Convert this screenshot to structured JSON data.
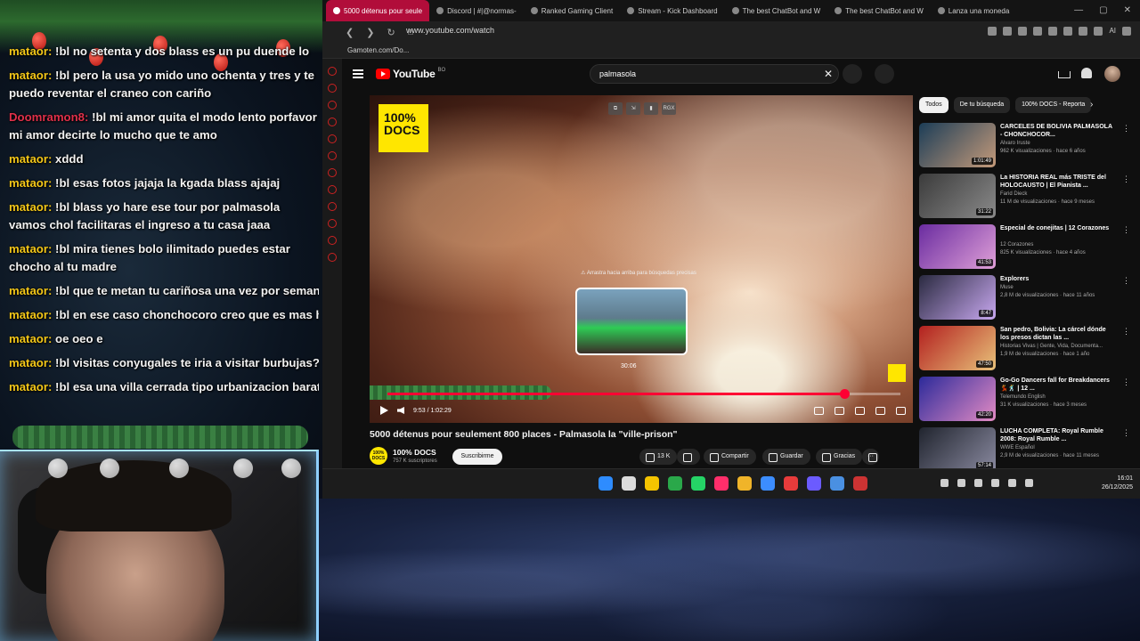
{
  "chat": {
    "messages": [
      {
        "user": "mataor:",
        "text": "!bl no setenta y dos blass es un pu duende lo",
        "red": false
      },
      {
        "user": "mataor:",
        "text": "!bl pero la usa yo mido uno ochenta y tres y te puedo reventar el craneo con cariño",
        "red": false
      },
      {
        "user": "Doomramon8:",
        "text": "!bl mi amor quita el modo lento porfavor mi amor decirte lo mucho que te amo",
        "red": true
      },
      {
        "user": "mataor:",
        "text": "xddd",
        "red": false
      },
      {
        "user": "mataor:",
        "text": "!bl esas fotos jajaja la kgada blass ajajaj",
        "red": false
      },
      {
        "user": "mataor:",
        "text": "!bl blass yo hare ese tour por palmasola vamos chol facilitaras el ingreso a tu casa jaaa",
        "red": false
      },
      {
        "user": "mataor:",
        "text": "!bl mira tienes bolo ilimitado puedes estar chocho al tu madre",
        "red": false
      },
      {
        "user": "mataor:",
        "text": "!bl que te metan tu cariñosa una vez por semana y b",
        "red": false
      },
      {
        "user": "mataor:",
        "text": "!bl en ese caso chonchocoro creo que es mas heavy",
        "red": false
      },
      {
        "user": "mataor:",
        "text": "oe oeo e",
        "red": false
      },
      {
        "user": "mataor:",
        "text": "!bl visitas conyugales te iria a visitar burbujas?",
        "red": false
      },
      {
        "user": "mataor:",
        "text": "!bl esa una villa cerrada tipo urbanizacion barata",
        "red": false
      }
    ]
  },
  "browser": {
    "tabs": [
      {
        "label": "5000 détenus pour seule",
        "active": true
      },
      {
        "label": "Discord | #|@normas-",
        "active": false
      },
      {
        "label": "Ranked Gaming Client",
        "active": false
      },
      {
        "label": "Stream - Kick Dashboard",
        "active": false
      },
      {
        "label": "The best ChatBot and W",
        "active": false
      },
      {
        "label": "The best ChatBot and W",
        "active": false
      },
      {
        "label": "Lanza una moneda",
        "active": false
      }
    ],
    "url": "www.youtube.com/watch",
    "ext_ai": "AI",
    "bookmark": "Gamoten.com/Do..."
  },
  "youtube": {
    "logo": "YouTube",
    "logo_cc": "BO",
    "search_value": "palmasola",
    "player": {
      "badge_line1": "100%",
      "badge_line2": "DOCS",
      "tools": [
        "⧉",
        "⇲",
        "▮",
        "RGX"
      ],
      "drag_hint": "⚠ Arrastra hacia arriba para búsquedas precisas",
      "preview_time": "30:06",
      "time": "9:53 / 1:02:29",
      "progress": 0.89
    },
    "title": "5000 détenus pour seulement 800 places - Palmasola la \"ville-prison\"",
    "channel": {
      "name": "100% DOCS",
      "subs": "757 K suscriptores",
      "avatar": "100% DOCS"
    },
    "subscribe_label": "Suscribirme",
    "actions": {
      "likes": "13 K",
      "share": "Compartir",
      "save": "Guardar",
      "thanks": "Gracias"
    },
    "chips": [
      {
        "label": "Todos",
        "active": true
      },
      {
        "label": "De tu búsqueda",
        "active": false
      },
      {
        "label": "100% DOCS - Reporta",
        "active": false
      }
    ],
    "recommendations": [
      {
        "title": "CARCELES DE BOLIVIA PALMASOLA - CHONCHOCOR...",
        "channel": "Alvaro Iruste",
        "meta": "962 K visualizaciones · hace 6 años",
        "duration": "1:01:49",
        "c1": "#1c3d57",
        "c2": "#c49a7a"
      },
      {
        "title": "La HISTORIA REAL más TRISTE del HOLOCAUSTO | El Pianista ...",
        "channel": "Farid Dieck",
        "meta": "11 M de visualizaciones · hace 9 meses",
        "duration": "31:22",
        "c1": "#3b3b3b",
        "c2": "#8a8a8a"
      },
      {
        "title": "Especial de conejitas | 12 Corazones",
        "channel": "12 Corazones",
        "meta": "825 K visualizaciones · hace 4 años",
        "duration": "41:53",
        "c1": "#6a2ca0",
        "c2": "#e0a0d8"
      },
      {
        "title": "Explorers",
        "channel": "Muse",
        "meta": "2,8 M de visualizaciones · hace 11 años",
        "duration": "8:47",
        "c1": "#2a2a40",
        "c2": "#c8a8f0"
      },
      {
        "title": "San pedro, Bolivia: La cárcel dónde los presos dictan las ...",
        "channel": "Historias Vivas | Gente, Vida, Documenta...",
        "meta": "1,9 M de visualizaciones · hace 1 año",
        "duration": "47:50",
        "c1": "#b3201f",
        "c2": "#e8c27a"
      },
      {
        "title": "Go-Go Dancers fall for Breakdancers 💃🕺 | 12 ...",
        "channel": "Telemundo English",
        "meta": "31 K visualizaciones · hace 3 meses",
        "duration": "42:20",
        "c1": "#2c2a9a",
        "c2": "#e38bc4"
      },
      {
        "title": "LUCHA COMPLETA: Royal Rumble 2008: Royal Rumble ...",
        "channel": "WWE Español",
        "meta": "2,9 M de visualizaciones · hace 11 meses",
        "duration": "57:14",
        "c1": "#20242e",
        "c2": "#8a8aa0"
      }
    ]
  },
  "taskbar": {
    "apps": [
      {
        "color": "#2e8cff"
      },
      {
        "color": "#dcdcdc"
      },
      {
        "color": "#f5c400"
      },
      {
        "color": "#2aa84a"
      },
      {
        "color": "#25d366"
      },
      {
        "color": "#ff2e6a"
      },
      {
        "color": "#f0b429"
      },
      {
        "color": "#3c8dff"
      },
      {
        "color": "#e83b3b"
      },
      {
        "color": "#6b5bff"
      },
      {
        "color": "#4a90e2"
      },
      {
        "color": "#cc3333"
      }
    ],
    "time": "16:01",
    "date": "26/12/2025"
  }
}
